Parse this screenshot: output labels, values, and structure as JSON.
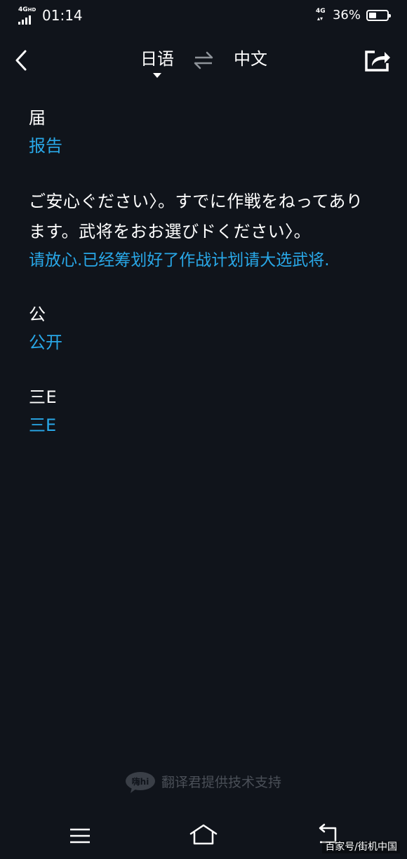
{
  "status_bar": {
    "network_left": "4G",
    "network_left_sup": "HD",
    "time": "01:14",
    "network_right": "4G",
    "battery_percent": "36%",
    "battery_level": 0.36
  },
  "header": {
    "source_lang": "日语",
    "target_lang": "中文",
    "swap_symbol": "⇌"
  },
  "entries": [
    {
      "source": "届",
      "translation": "报告"
    },
    {
      "source": "ご安心ぐださい〉。すでに作戦をねってあります。武将をおお選びドください〉。",
      "translation": "请放心.已经筹划好了作战计划请大选武将."
    },
    {
      "source": "公",
      "translation": "公开"
    },
    {
      "source": "三E",
      "translation": "三E"
    }
  ],
  "footer": {
    "logo_text": "嗨hi",
    "credit": "翻译君提供技术支持"
  },
  "watermark": "百家号/街机中国",
  "colors": {
    "background": "#10141b",
    "translation": "#29a8e8",
    "credit": "#4a4f57"
  }
}
